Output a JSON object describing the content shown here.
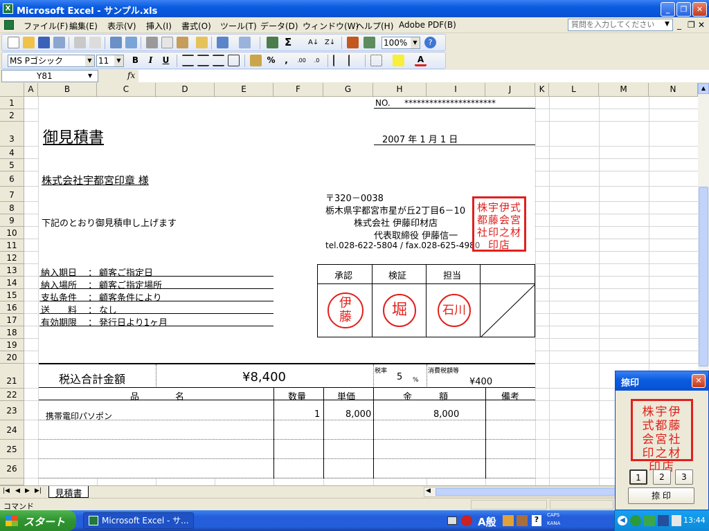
{
  "window": {
    "title": "Microsoft Excel - サンプル.xls"
  },
  "menu": {
    "items": [
      "ファイル(F)",
      "編集(E)",
      "表示(V)",
      "挿入(I)",
      "書式(O)",
      "ツール(T)",
      "データ(D)",
      "ウィンドウ(W)",
      "ヘルプ(H)",
      "Adobe PDF(B)"
    ],
    "help_placeholder": "質問を入力してください"
  },
  "toolbar": {
    "zoom": "100%",
    "font_name": "MS Pゴシック",
    "font_size": "11"
  },
  "formula": {
    "name_box": "Y81",
    "fx": "fx"
  },
  "columns": [
    "A",
    "B",
    "C",
    "D",
    "E",
    "F",
    "G",
    "H",
    "I",
    "J",
    "K",
    "L",
    "M",
    "N"
  ],
  "rows": [
    "1",
    "2",
    "3",
    "4",
    "5",
    "6",
    "7",
    "8",
    "9",
    "10",
    "11",
    "12",
    "13",
    "14",
    "15",
    "16",
    "17",
    "18",
    "19",
    "20",
    "21",
    "22",
    "23",
    "24",
    "25",
    "26"
  ],
  "doc": {
    "no_label": "NO.",
    "no_value": "**********************",
    "title": "御見積書",
    "date": "2007  年    1  月  1  日",
    "customer": "株式会社宇都宮印章  様",
    "intro": "下記のとおり御見積申し上げます",
    "zip": "〒320－0038",
    "address": "栃木県宇都宮市星が丘2丁目6－10",
    "company": "株式会社 伊藤印材店",
    "rep": "代表取締役  伊藤信一",
    "contact": "tel.028-622-5804  /  fax.028-625-4980",
    "terms": [
      {
        "label": "納入期日",
        "value": "顧客ご指定日"
      },
      {
        "label": "納入場所",
        "value": "顧客ご指定場所"
      },
      {
        "label": "支払条件",
        "value": "顧客条件により"
      },
      {
        "label": "送　　料",
        "value": "なし"
      },
      {
        "label": "有効期限",
        "value": "発行日より1ヶ月"
      }
    ],
    "approval": {
      "headers": [
        "承認",
        "検証",
        "担当"
      ],
      "seals": [
        "伊藤",
        "堀",
        "石川"
      ]
    },
    "total_label": "税込合計金額",
    "total_value": "¥8,400",
    "tax_rate_label": "税率",
    "tax_rate": "5",
    "tax_rate_unit": "%",
    "tax_amount_label": "消費税額等",
    "tax_amount": "¥400",
    "table_headers": {
      "item": "品　　　　名",
      "qty": "数量",
      "unit": "単価",
      "amount": "金　　　額",
      "note": "備考"
    },
    "items": [
      {
        "name": "携帯電印パソポン",
        "qty": "1",
        "unit": "8,000",
        "amount": "8,000"
      }
    ],
    "company_seal": "株宇伊式都藤会宮社印之材印店"
  },
  "sheet_tab": "見積書",
  "status": {
    "left": "コマンド"
  },
  "dialog": {
    "title": "捺印",
    "pages": [
      "1",
      "2",
      "3"
    ],
    "action": "捺 印"
  },
  "taskbar": {
    "start": "スタート",
    "task": "Microsoft Excel - サ...",
    "ime": "A般",
    "caps": "CAPS",
    "kana": "KANA",
    "time": "13:44"
  }
}
